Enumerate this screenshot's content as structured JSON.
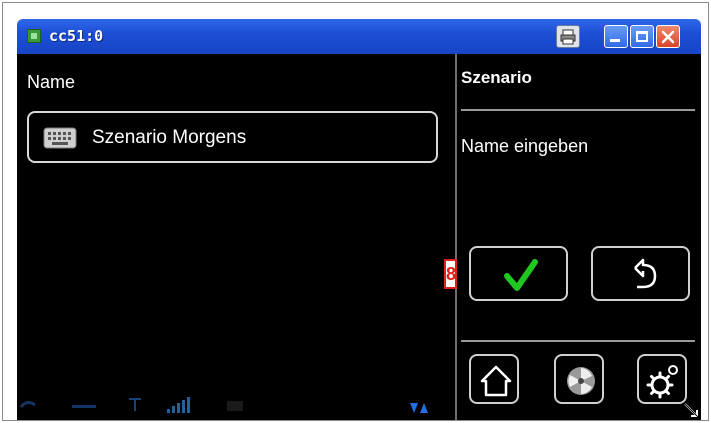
{
  "window": {
    "title": "cc51:0",
    "buttons": [
      "print",
      "minimize",
      "maximize",
      "close"
    ]
  },
  "left_pane": {
    "label": "Name",
    "input": {
      "value": "Szenario Morgens",
      "icon": "keyboard-icon"
    }
  },
  "right_pane": {
    "title": "Szenario",
    "subtitle": "Name eingeben",
    "confirm_icon": "checkmark-icon",
    "back_icon": "back-arrow-icon",
    "nav_icons": [
      "home-icon",
      "fan-icon",
      "gear-icon"
    ]
  },
  "badge": {
    "value": "8"
  },
  "colors": {
    "titlebar": "#1d4fd6",
    "screen_bg": "#000000",
    "check": "#1ec81e",
    "badge_border": "#e0201a"
  }
}
